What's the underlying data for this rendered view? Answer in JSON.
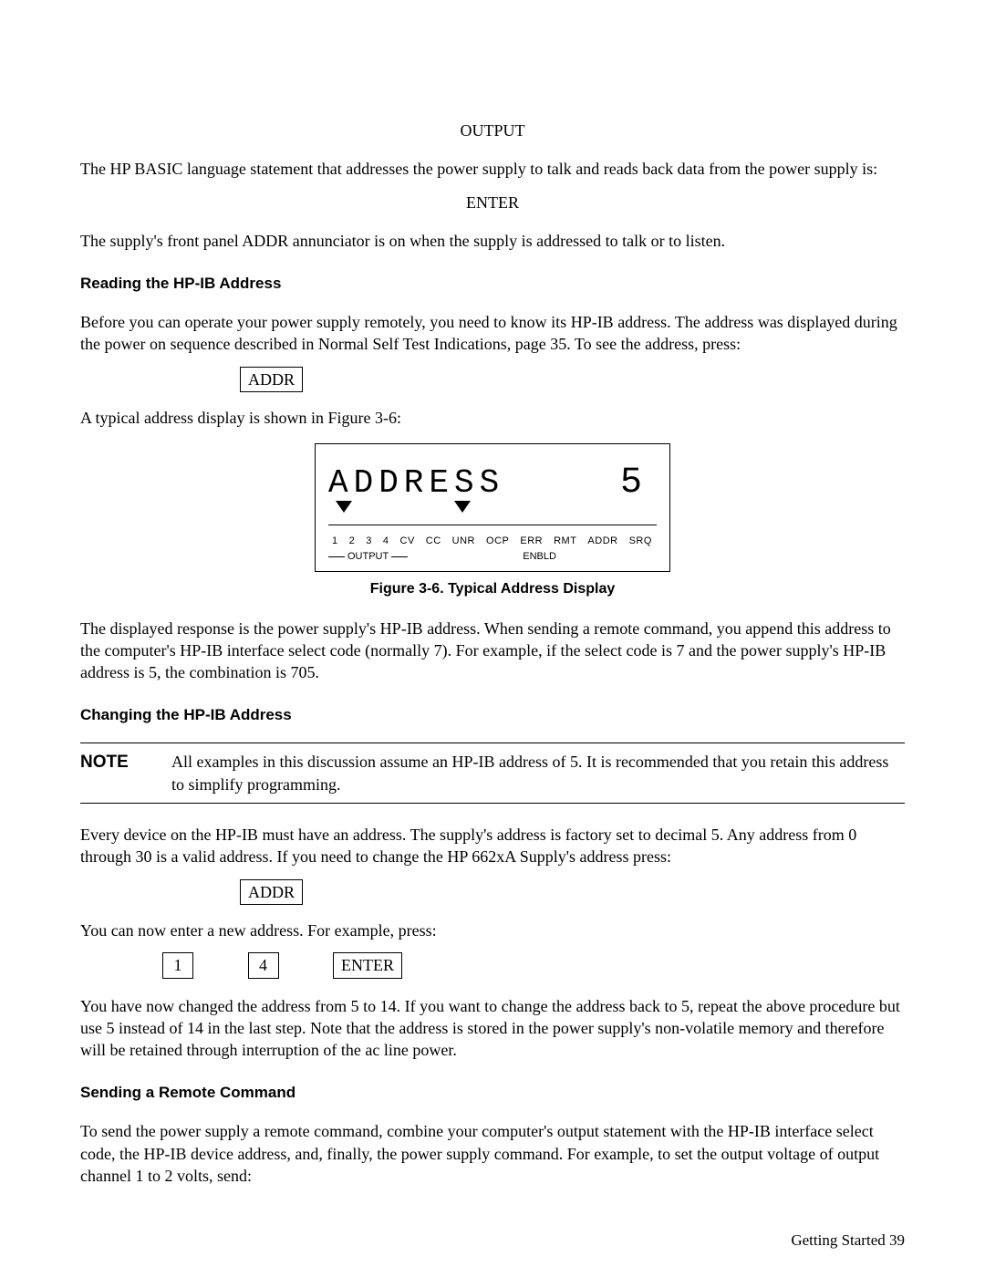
{
  "words": {
    "output": "OUTPUT",
    "enter_word": "ENTER"
  },
  "para1": "The HP BASIC language statement that addresses the power supply to talk and reads back data from the power supply is:",
  "para2": "The supply's front panel ADDR annunciator is on when the supply is addressed to talk or to listen.",
  "heading1": "Reading the HP-IB Address",
  "para3": "Before you can operate your power supply remotely, you need to know its HP-IB address. The address was displayed during the power on sequence described in Normal Self Test Indications, page 35. To see the address, press:",
  "key_addr": "ADDR",
  "para4": "A typical address display is shown in Figure 3-6:",
  "display": {
    "address_label": "ADDRESS",
    "address_value": "5",
    "ann": {
      "n1": "1",
      "n2": "2",
      "n3": "3",
      "n4": "4",
      "cv": "CV",
      "cc": "CC",
      "unr": "UNR",
      "ocp": "OCP",
      "err": "ERR",
      "rmt": "RMT",
      "addr": "ADDR",
      "srq": "SRQ"
    },
    "output_label": "OUTPUT",
    "enbld": "ENBLD"
  },
  "figure_caption": "Figure 3-6. Typical Address Display",
  "para5": "The displayed response is the power supply's HP-IB address. When sending a remote command, you append this address to the computer's HP-IB interface select code (normally 7). For example, if the select code is 7 and the power supply's HP-IB address is 5, the combination is 705.",
  "heading2": "Changing the HP-IB Address",
  "note_label": "NOTE",
  "note_text": "All examples in this discussion assume an HP-IB address of 5. It is recommended that you retain this address to simplify programming.",
  "para6": "Every device on the HP-IB must have an address. The supply's address is factory set to decimal 5. Any address from 0 through 30 is a valid address. If you need to change the HP 662xA Supply's address press:",
  "para7": "You can now enter a new address. For example, press:",
  "keys2": {
    "k1": "1",
    "k4": "4",
    "enter": "ENTER"
  },
  "para8": "You have now changed the address from 5 to 14. If you want to change the address back to 5, repeat the above procedure but use 5 instead of 14 in the last step. Note that the address is stored in the power supply's non-volatile memory and therefore will be retained through interruption of the ac line power.",
  "heading3": "Sending a Remote Command",
  "para9": "To send the power supply a remote command, combine your computer's output statement with the HP-IB interface select code, the HP-IB device address, and, finally, the power supply command. For example, to set the output voltage of output channel 1 to 2 volts, send:",
  "footer": "Getting Started   39"
}
